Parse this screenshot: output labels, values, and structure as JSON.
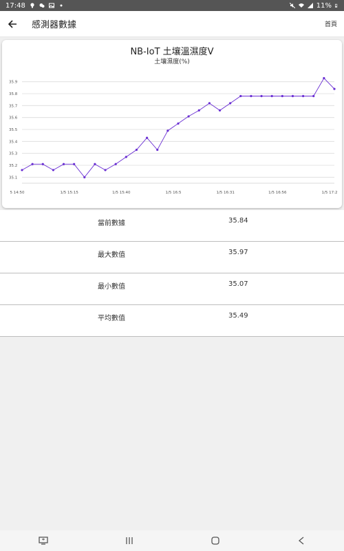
{
  "status_bar": {
    "time": "17:48",
    "battery": "11%",
    "left_icons": [
      "lightbulb-icon",
      "chat-icon",
      "image-icon",
      "dot-icon"
    ],
    "right_icons": [
      "mute-icon",
      "wifi-icon",
      "signal-icon",
      "battery-icon"
    ]
  },
  "app_bar": {
    "title": "感測器數據",
    "home_label": "首頁"
  },
  "chart_data": {
    "type": "line",
    "title": "NB-IoT 土壤溫濕度V",
    "subtitle": "土壤濕度(%)",
    "color": "#6a2fd3",
    "ylim": [
      35.05,
      35.95
    ],
    "yticks": [
      "35.1",
      "35.2",
      "35.3",
      "35.4",
      "35.5",
      "35.6",
      "35.7",
      "35.8",
      "35.9"
    ],
    "xticks": [
      "5 14:50",
      "1/5 15:15",
      "1/5 15:40",
      "1/5 16:5",
      "1/5 16:31",
      "1/5 16:56",
      "1/5 17:2"
    ],
    "values": [
      35.16,
      35.21,
      35.21,
      35.16,
      35.21,
      35.21,
      35.1,
      35.21,
      35.16,
      35.21,
      35.27,
      35.33,
      35.43,
      35.33,
      35.49,
      35.55,
      35.61,
      35.66,
      35.72,
      35.66,
      35.72,
      35.78,
      35.78,
      35.78,
      35.78,
      35.78,
      35.78,
      35.78,
      35.78,
      35.93,
      35.84
    ],
    "grid": true
  },
  "stats": [
    {
      "label": "當前數據",
      "value": "35.84"
    },
    {
      "label": "最大數值",
      "value": "35.97"
    },
    {
      "label": "最小數值",
      "value": "35.07"
    },
    {
      "label": "平均數值",
      "value": "35.49"
    }
  ],
  "nav_bar": [
    "screenshot-icon",
    "recents-icon",
    "home-icon",
    "back-icon"
  ]
}
